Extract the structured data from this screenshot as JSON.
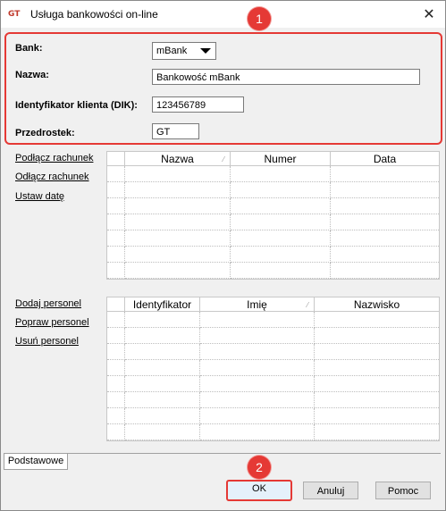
{
  "window": {
    "title": "Usługa bankowości on-line",
    "icon_text": "GT",
    "close_glyph": "✕"
  },
  "markers": {
    "one": "1",
    "two": "2"
  },
  "form": {
    "bank_label": "Bank:",
    "bank_value": "mBank",
    "name_label": "Nazwa:",
    "name_value": "Bankowość mBank",
    "client_id_label": "Identyfikator klienta (DIK):",
    "client_id_value": "123456789",
    "prefix_label": "Przedrostek:",
    "prefix_value": "GT"
  },
  "accounts": {
    "links": [
      "Podłącz rachunek",
      "Odłącz rachunek",
      "Ustaw datę"
    ],
    "columns": [
      "Nazwa",
      "Numer",
      "Data"
    ]
  },
  "personnel": {
    "links": [
      "Dodaj personel",
      "Popraw personel",
      "Usuń personel"
    ],
    "columns": [
      "Identyfikator",
      "Imię",
      "Nazwisko"
    ]
  },
  "tabs": [
    "Podstawowe"
  ],
  "buttons": {
    "ok": "OK",
    "cancel": "Anuluj",
    "help": "Pomoc"
  }
}
